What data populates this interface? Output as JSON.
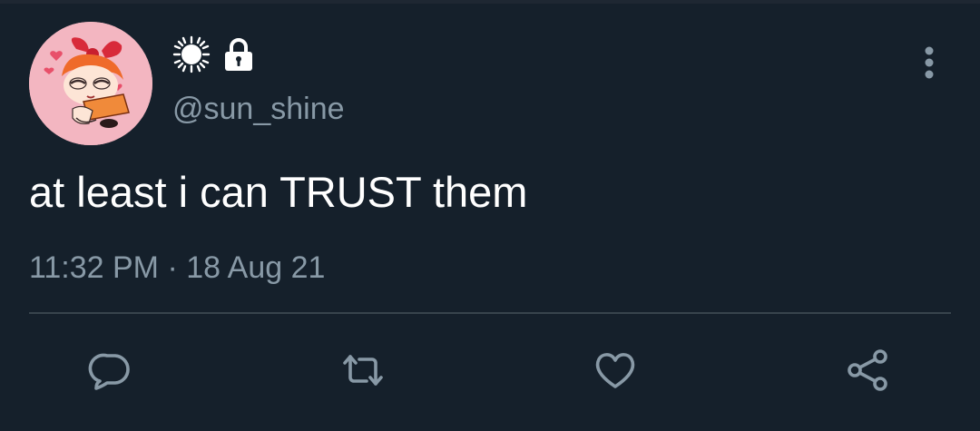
{
  "tweet": {
    "handle": "@sun_shine",
    "text": "at least i can TRUST them",
    "time": "11:32 PM",
    "separator": "·",
    "date": "18 Aug 21"
  },
  "icons": {
    "avatar": "powerpuff-blossom-avatar",
    "name": "sun-glyph",
    "protected": "lock-icon",
    "more": "vertical-dots-icon",
    "actions": [
      "reply-icon",
      "retweet-icon",
      "like-heart-icon",
      "share-icon"
    ]
  },
  "colors": {
    "background": "#15202b",
    "text": "#ffffff",
    "secondary_text": "#8899a6",
    "divider": "#38444d",
    "avatar_bg": "#f3b6c1"
  }
}
